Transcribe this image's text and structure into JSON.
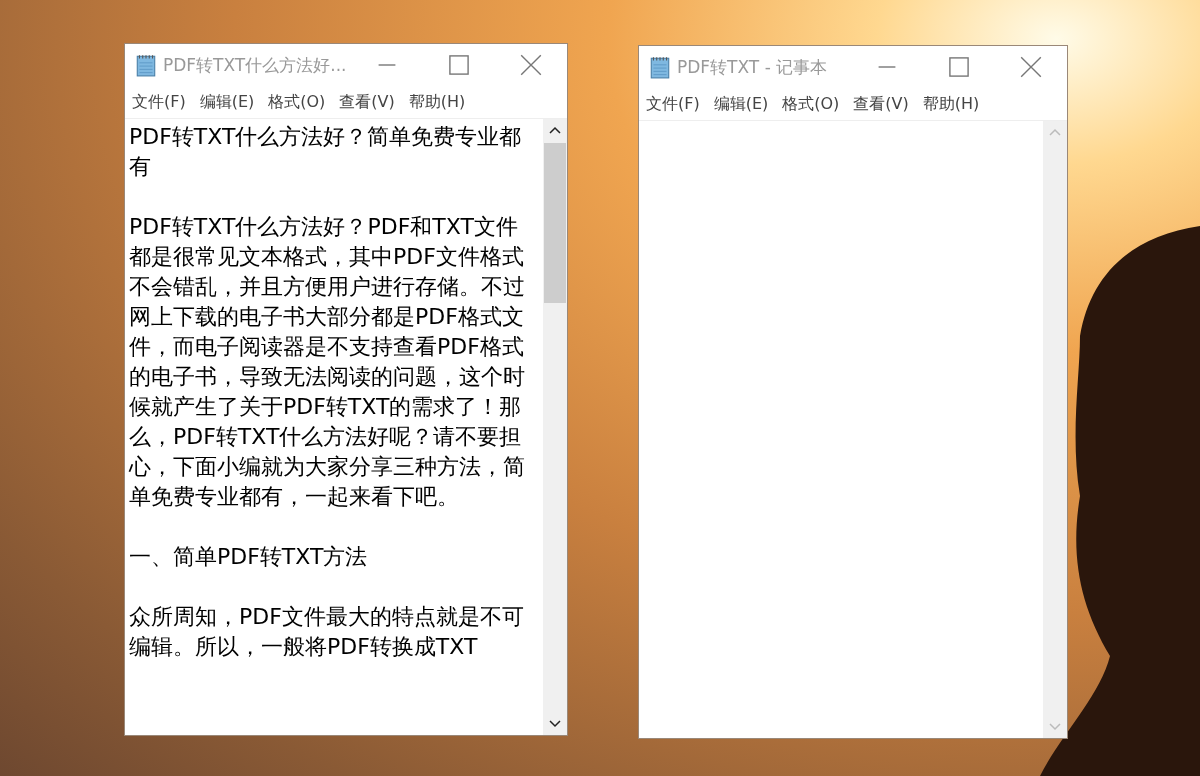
{
  "windows": [
    {
      "title": "PDF转TXT什么方法好...",
      "menu": [
        "文件(F)",
        "编辑(E)",
        "格式(O)",
        "查看(V)",
        "帮助(H)"
      ],
      "paragraphs": [
        "PDF转TXT什么方法好？简单免费专业都有",
        "PDF转TXT什么方法好？PDF和TXT文件都是很常见文本格式，其中PDF文件格式不会错乱，并且方便用户进行存储。不过网上下载的电子书大部分都是PDF格式文件，而电子阅读器是不支持查看PDF格式的电子书，导致无法阅读的问题，这个时候就产生了关于PDF转TXT的需求了！那么，PDF转TXT什么方法好呢？请不要担心，下面小编就为大家分享三种方法，简单免费专业都有，一起来看下吧。",
        "一、简单PDF转TXT方法",
        "众所周知，PDF文件最大的特点就是不可编辑。所以，一般将PDF转换成TXT"
      ]
    },
    {
      "title": "PDF转TXT - 记事本",
      "menu": [
        "文件(F)",
        "编辑(E)",
        "格式(O)",
        "查看(V)",
        "帮助(H)"
      ]
    }
  ]
}
